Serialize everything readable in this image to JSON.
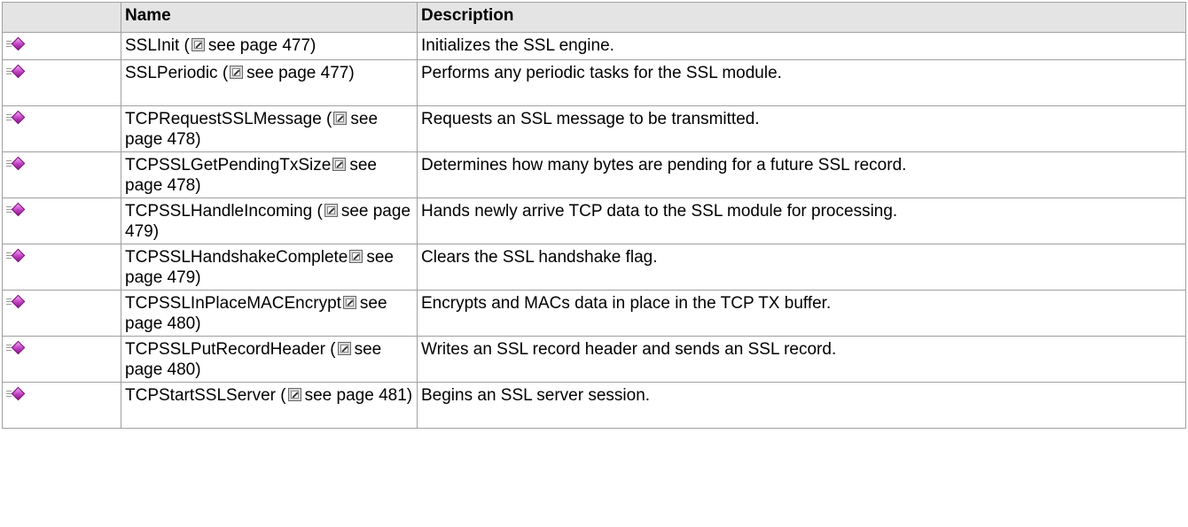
{
  "table": {
    "headers": {
      "icon": "",
      "name": "Name",
      "description": "Description"
    },
    "rows": [
      {
        "name": "SSLInit (",
        "see_page": "see page 477)",
        "description": "Initializes the SSL engine."
      },
      {
        "name": "SSLPeriodic (",
        "see_page": "see page 477)",
        "description": "Performs any periodic tasks for the SSL module."
      },
      {
        "name": "TCPRequestSSLMessage (",
        "see_page": "see page 478)",
        "description": "Requests an SSL message to be transmitted."
      },
      {
        "name": "TCPSSLGetPendingTxSize",
        "see_page": "see page 478)",
        "description": "Determines how many bytes are pending for a future SSL record."
      },
      {
        "name": "TCPSSLHandleIncoming (",
        "see_page": "see page 479)",
        "description": "Hands newly arrive TCP data to the SSL module for processing."
      },
      {
        "name": "TCPSSLHandshakeComplete",
        "see_page": "see page 479)",
        "description": "Clears the SSL handshake flag."
      },
      {
        "name": "TCPSSLInPlaceMACEncrypt",
        "see_page": "see page 480)",
        "description": "Encrypts and MACs data in place in the TCP TX buffer."
      },
      {
        "name": "TCPSSLPutRecordHeader (",
        "see_page": "see page 480)",
        "description": "Writes an SSL record header and sends an SSL record."
      },
      {
        "name": "TCPStartSSLServer (",
        "see_page": "see page 481)",
        "description": "Begins an SSL server session."
      }
    ]
  },
  "icons": {
    "row_icon": "public-method-icon",
    "link_icon": "external-link-icon"
  }
}
